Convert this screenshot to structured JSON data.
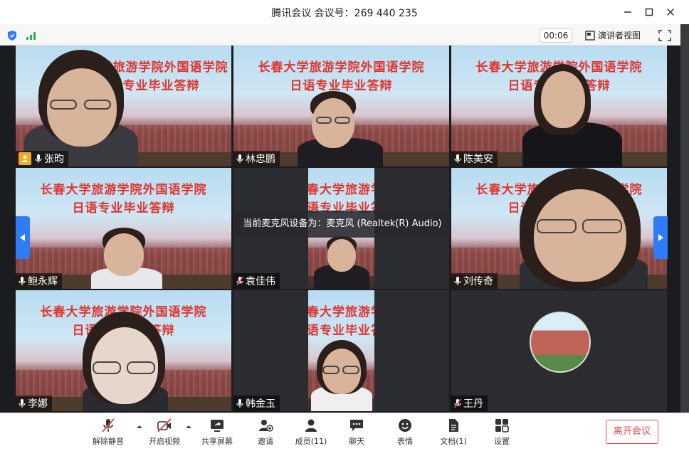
{
  "window": {
    "title": "腾讯会议 会议号：269 440 235"
  },
  "status": {
    "timer": "00:06",
    "speaker_view_label": "演讲者视图"
  },
  "banner": {
    "line1": "长春大学旅游学院外国语学院",
    "line2": "日语专业毕业答辩"
  },
  "participants": [
    {
      "name": "张昀",
      "muted": false,
      "host": true
    },
    {
      "name": "林忠鹏",
      "muted": false,
      "host": false
    },
    {
      "name": "陈美安",
      "muted": false,
      "host": false,
      "active": true
    },
    {
      "name": "鲍永辉",
      "muted": false,
      "host": false
    },
    {
      "name": "袁佳伟",
      "muted": true,
      "host": false
    },
    {
      "name": "刘传奇",
      "muted": false,
      "host": false
    },
    {
      "name": "李娜",
      "muted": false,
      "host": false
    },
    {
      "name": "韩金玉",
      "muted": false,
      "host": false
    },
    {
      "name": "王丹",
      "muted": true,
      "host": false
    }
  ],
  "tooltip": "当前麦克风设备为：麦克风 (Realtek(R) Audio)",
  "toolbar": {
    "unmute": "解除静音",
    "start_video": "开启视频",
    "share_screen": "共享屏幕",
    "invite": "邀请",
    "members": "成员(11)",
    "chat": "聊天",
    "reactions": "表情",
    "docs": "文档(1)",
    "settings": "设置",
    "leave": "离开会议"
  },
  "colors": {
    "accent": "#2e7cf6",
    "active_speaker": "#36c85a",
    "leave": "#e24a4a",
    "host_badge": "#f5a623",
    "banner_text": "#e0342e"
  }
}
